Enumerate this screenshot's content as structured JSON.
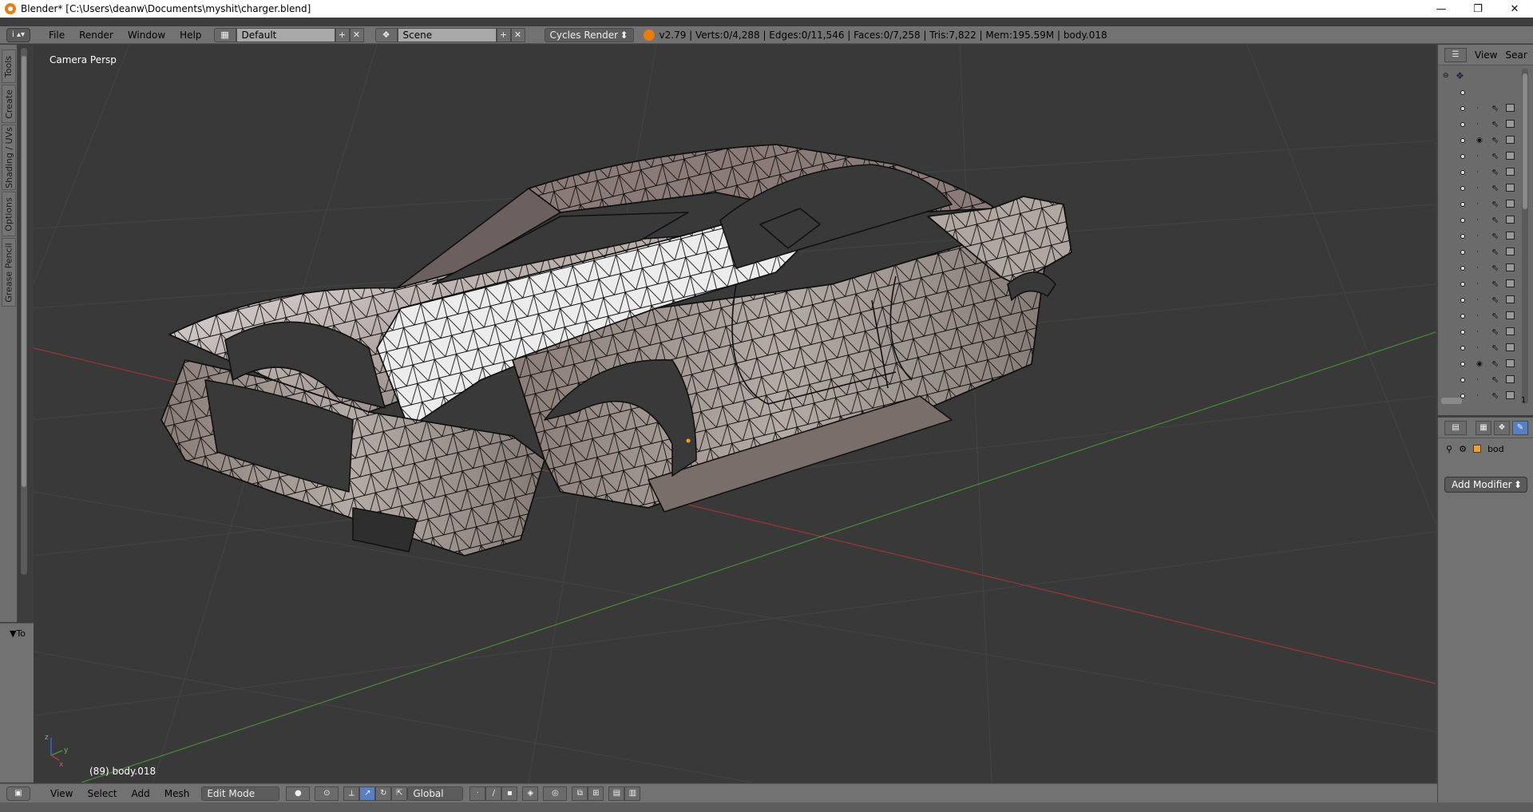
{
  "window": {
    "title": "Blender* [C:\\Users\\deanw\\Documents\\myshit\\charger.blend]",
    "minimize_glyph": "—",
    "maximize_glyph": "❐",
    "close_glyph": "✕"
  },
  "info_header": {
    "editor_glyph": "i ▴▾",
    "menus": [
      "File",
      "Render",
      "Window",
      "Help"
    ],
    "screen_layout": "Default",
    "scene": "Scene",
    "render_engine": "Cycles Render",
    "stats": "v2.79 | Verts:0/4,288 | Edges:0/11,546 | Faces:0/7,258 | Tris:7,822 | Mem:195.59M | body.018",
    "plus_glyph": "+",
    "x_glyph": "✕",
    "dropdown_glyph": "⬍"
  },
  "tool_shelf": {
    "tabs": [
      "Tools",
      "Create",
      "Shading / UVs",
      "Options",
      "Grease Pencil"
    ],
    "panel_label": "▼To"
  },
  "viewport": {
    "view_name": "Camera Persp",
    "object_info": "(89) body.018",
    "axis_x": "x",
    "axis_y": "y",
    "axis_z": "z"
  },
  "view_header": {
    "menus": [
      "View",
      "Select",
      "Add",
      "Mesh"
    ],
    "mode": "Edit Mode",
    "orientation": "Global"
  },
  "outliner": {
    "header_label_view": "View",
    "header_label_search": "Sear",
    "page_number": "1",
    "row_count": 21
  },
  "properties": {
    "object_name": "bod",
    "add_modifier_label": "Add Modifier"
  },
  "colors": {
    "ui_panel": "#727272",
    "viewport_bg": "#393939",
    "grid_line": "#444444",
    "x_axis": "#9a3535",
    "y_axis": "#4a8a3a",
    "mesh_fill": "#c9c2c0",
    "mesh_wire": "#111111",
    "blender_orange": "#e87d0d"
  },
  "icons": [
    "blender-logo-icon",
    "editor-type-icon",
    "screen-layout-icon",
    "scene-icon",
    "eye-icon",
    "cursor-icon",
    "camera-icon",
    "wrench-icon",
    "cube-icon",
    "pin-icon"
  ]
}
